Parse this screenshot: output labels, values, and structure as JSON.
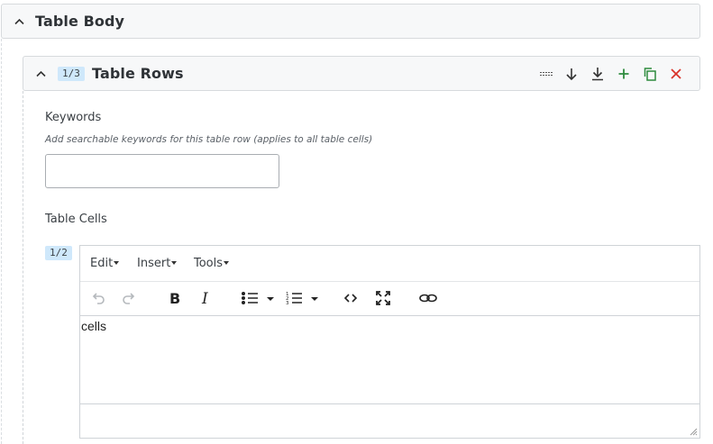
{
  "table_body": {
    "title": "Table Body"
  },
  "table_rows": {
    "badge": "1/3",
    "title": "Table Rows",
    "actions": [
      "drag-handle",
      "move-down",
      "move-to-bottom",
      "add",
      "duplicate",
      "remove"
    ]
  },
  "keywords": {
    "label": "Keywords",
    "hint": "Add searchable keywords for this table row (applies to all table cells)",
    "value": ""
  },
  "table_cells": {
    "label": "Table Cells",
    "badge": "1/2",
    "editor": {
      "menus": [
        "Edit",
        "Insert",
        "Tools"
      ],
      "toolbar": [
        "undo-icon",
        "redo-icon",
        "bold-icon",
        "italic-icon",
        "bullet-list-icon",
        "numbered-list-icon",
        "source-code-icon",
        "fullscreen-icon",
        "link-icon"
      ],
      "content": "cells"
    }
  },
  "colors": {
    "accent_green": "#2e8b3e",
    "danger_red": "#d9342b",
    "badge_bg": "#cfe8fb"
  }
}
